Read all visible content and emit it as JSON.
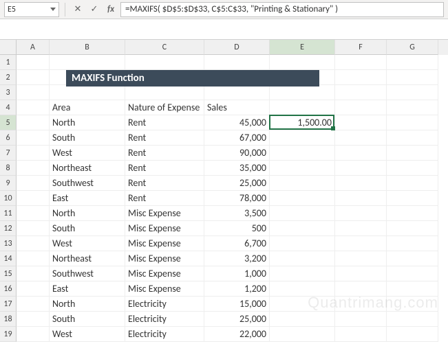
{
  "name_box": "E5",
  "formula": "=MAXIFS( $D$5:$D$33, C$5:C$33, \"Printing & Stationary\" )",
  "columns": [
    "A",
    "B",
    "C",
    "D",
    "E",
    "F",
    "G"
  ],
  "row_numbers": [
    "1",
    "2",
    "3",
    "4",
    "5",
    "6",
    "7",
    "8",
    "9",
    "10",
    "11",
    "12",
    "13",
    "14",
    "15",
    "16",
    "17",
    "18",
    "19"
  ],
  "banner_title": "MAXIFS Function",
  "headers": {
    "area": "Area",
    "nature": "Nature of Expense",
    "sales": "Sales"
  },
  "selected_value": "1,500.00",
  "data_rows": [
    {
      "area": "North",
      "nature": "Rent",
      "sales": "45,000"
    },
    {
      "area": "South",
      "nature": "Rent",
      "sales": "67,000"
    },
    {
      "area": "West",
      "nature": "Rent",
      "sales": "90,000"
    },
    {
      "area": "Northeast",
      "nature": "Rent",
      "sales": "35,000"
    },
    {
      "area": "Southwest",
      "nature": "Rent",
      "sales": "25,000"
    },
    {
      "area": "East",
      "nature": "Rent",
      "sales": "78,000"
    },
    {
      "area": "North",
      "nature": "Misc Expense",
      "sales": "3,500"
    },
    {
      "area": "South",
      "nature": "Misc Expense",
      "sales": "500"
    },
    {
      "area": "West",
      "nature": "Misc Expense",
      "sales": "6,700"
    },
    {
      "area": "Northeast",
      "nature": "Misc Expense",
      "sales": "3,200"
    },
    {
      "area": "Southwest",
      "nature": "Misc Expense",
      "sales": "1,000"
    },
    {
      "area": "East",
      "nature": "Misc Expense",
      "sales": "1,200"
    },
    {
      "area": "North",
      "nature": "Electricity",
      "sales": "15,000"
    },
    {
      "area": "South",
      "nature": "Electricity",
      "sales": "25,000"
    },
    {
      "area": "West",
      "nature": "Electricity",
      "sales": "22,000"
    }
  ],
  "watermark": "Quantrimang.com"
}
